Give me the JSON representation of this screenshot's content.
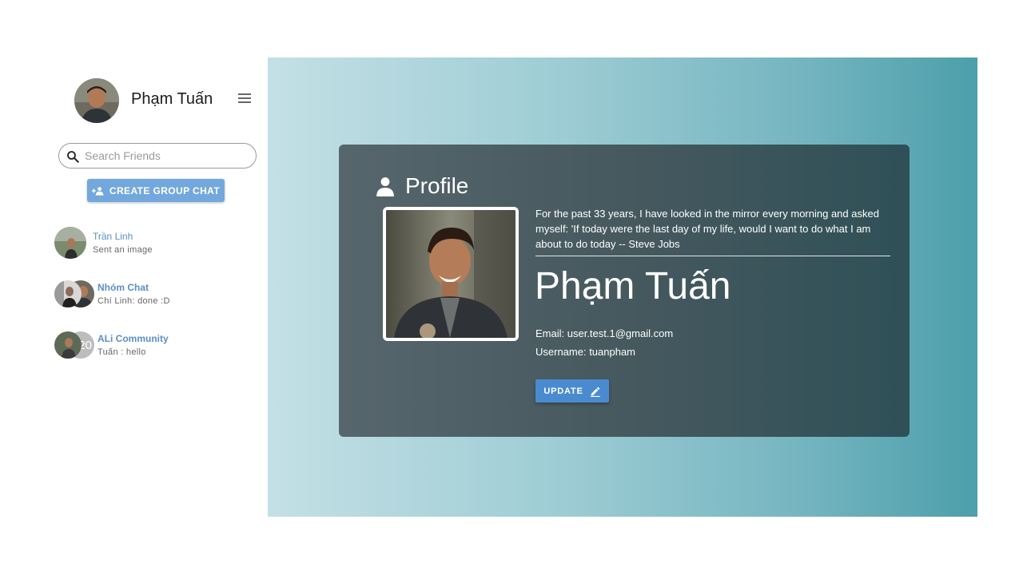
{
  "user": {
    "name": "Phạm Tuấn",
    "email_label": "Email: user.test.1@gmail.com",
    "username_label": "Username: tuanpham",
    "quote": "For the past 33 years, I have looked in the mirror every morning and asked myself: 'If today were the last day of my life, would I want to do what I am about to do today -- Steve Jobs"
  },
  "sidebar": {
    "search_placeholder": "Search Friends",
    "create_group_label": "CREATE GROUP CHAT",
    "chats": [
      {
        "title": "Trần Linh",
        "subtitle": "Sent an image",
        "type": "direct"
      },
      {
        "title": "Nhóm Chat",
        "subtitle": "Chí Linh: done :D",
        "type": "group"
      },
      {
        "title": "ALi Community",
        "subtitle": "Tuấn : hello",
        "type": "group",
        "badge": "20"
      }
    ]
  },
  "profile": {
    "heading": "Profile",
    "update_label": "UPDATE"
  },
  "colors": {
    "accent_button": "#4a8bd0",
    "create_button": "#73a8dc",
    "chat_title": "#5b8fc7"
  }
}
